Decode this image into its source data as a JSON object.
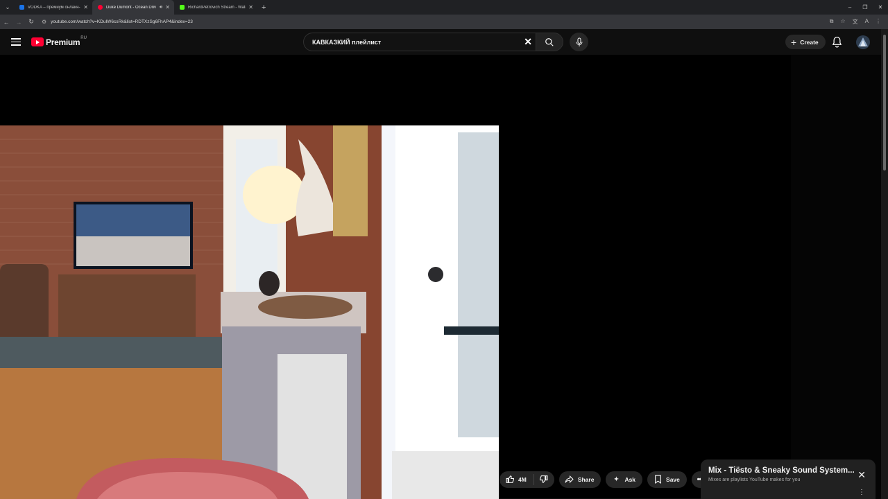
{
  "browser": {
    "tabs": [
      {
        "title": "VODKA – премиум онлайн-каз",
        "favicon_color": "#1a73e8",
        "active": false
      },
      {
        "title": "Duke Dumont - Ocean Driv",
        "favicon_color": "#ff0033",
        "active": true,
        "audio": true
      },
      {
        "title": "RichardPetrovich Stream - Watc",
        "favicon_color": "#53fc18",
        "active": false
      }
    ],
    "url": "youtube.com/watch?v=KDuIW6csRk&list=RDTXzSg6FhAP4&index=23"
  },
  "header": {
    "logo_word": "Premium",
    "country_code": "RU",
    "search_value": "КАВКАЗКИЙ плейлист",
    "create_label": "Create"
  },
  "actions": {
    "likes": "4M",
    "share_label": "Share",
    "ask_label": "Ask",
    "save_label": "Save"
  },
  "mix": {
    "title": "Mix - Tiësto & Sneaky Sound System...",
    "subtitle": "Mixes are playlists YouTube makes for you"
  },
  "colors": {
    "brand_red": "#ff0033",
    "background": "#0f0f0f",
    "pill": "#272727"
  }
}
